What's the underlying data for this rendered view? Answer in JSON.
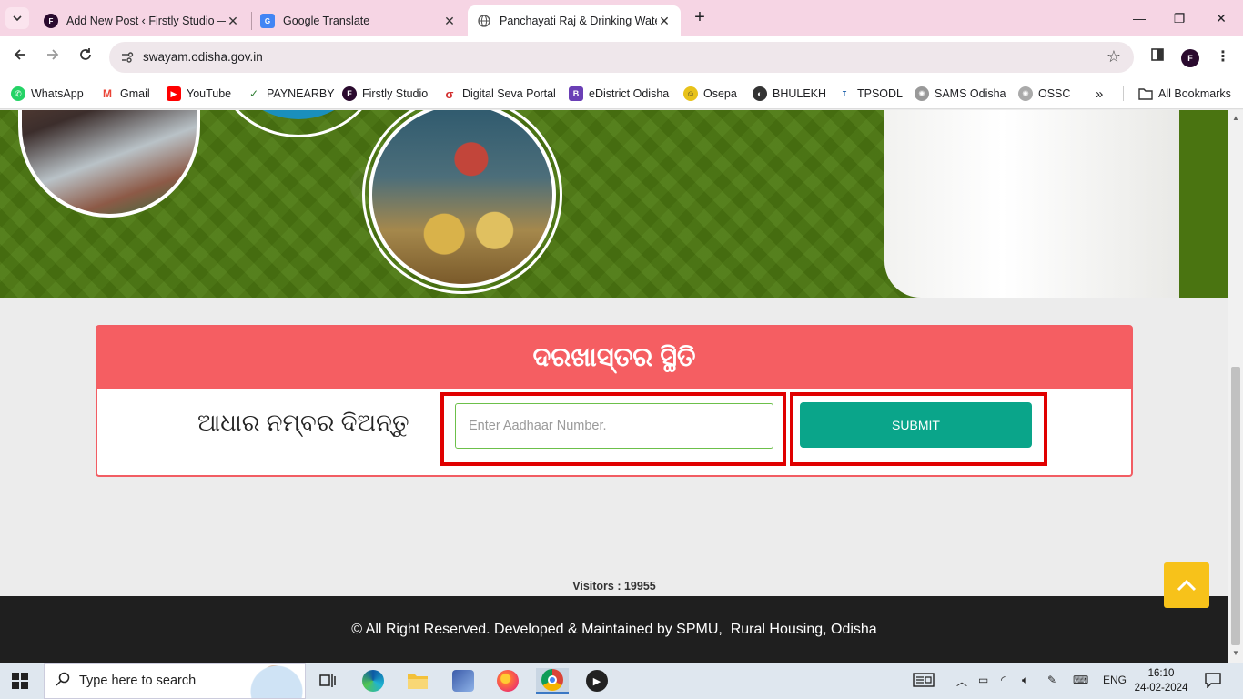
{
  "browser": {
    "tabs": [
      {
        "title": "Add New Post ‹ Firstly Studio —",
        "favicon": "firstly-studio-icon",
        "active": false
      },
      {
        "title": "Google Translate",
        "favicon": "google-translate-icon",
        "active": false
      },
      {
        "title": "Panchayati Raj & Drinking Wate",
        "favicon": "globe-icon",
        "active": true
      }
    ],
    "url": "swayam.odisha.gov.in",
    "bookmarks": [
      {
        "label": "WhatsApp",
        "icon": "whatsapp-icon",
        "color": "#25d366"
      },
      {
        "label": "Gmail",
        "icon": "gmail-icon",
        "color": "#ea4335"
      },
      {
        "label": "YouTube",
        "icon": "youtube-icon",
        "color": "#ff0000"
      },
      {
        "label": "PAYNEARBY",
        "icon": "paynearby-icon",
        "color": "#2e7d32"
      },
      {
        "label": "Firstly Studio",
        "icon": "firstly-studio-icon",
        "color": "#2a0a2e"
      },
      {
        "label": "Digital Seva Portal",
        "icon": "digital-seva-icon",
        "color": "#d32f2f"
      },
      {
        "label": "eDistrict Odisha",
        "icon": "edistrict-icon",
        "color": "#6a3fb5"
      },
      {
        "label": "Osepa",
        "icon": "osepa-icon",
        "color": "#c9a400"
      },
      {
        "label": "BHULEKH",
        "icon": "bhulekh-icon",
        "color": "#333333"
      },
      {
        "label": "TPSODL",
        "icon": "tpsodl-icon",
        "color": "#1a5ea8"
      },
      {
        "label": "SAMS Odisha",
        "icon": "sams-icon",
        "color": "#777777"
      },
      {
        "label": "OSSC",
        "icon": "ossc-icon",
        "color": "#888888"
      }
    ],
    "all_bookmarks": "All Bookmarks"
  },
  "page": {
    "card_title": "ଦରଖାସ୍ତର ସ୍ଥିତି",
    "aadhaar_label": "ଆଧାର ନମ୍ବର ଦିଅନ୍ତୁ",
    "aadhaar_placeholder": "Enter Aadhaar Number.",
    "submit_label": "SUBMIT",
    "visitors": "Visitors : 19955",
    "footer_text": "© All Right Reserved. Developed & Maintained by SPMU,  Rural Housing, Odisha"
  },
  "colors": {
    "card_header": "#f55e62",
    "submit": "#0aa58a",
    "banner_green": "#4e7a12",
    "highlight": "#e00000",
    "back_to_top": "#f7c21a"
  },
  "taskbar": {
    "search_placeholder": "Type here to search",
    "language": "ENG",
    "time": "16:10",
    "date": "24-02-2024"
  }
}
